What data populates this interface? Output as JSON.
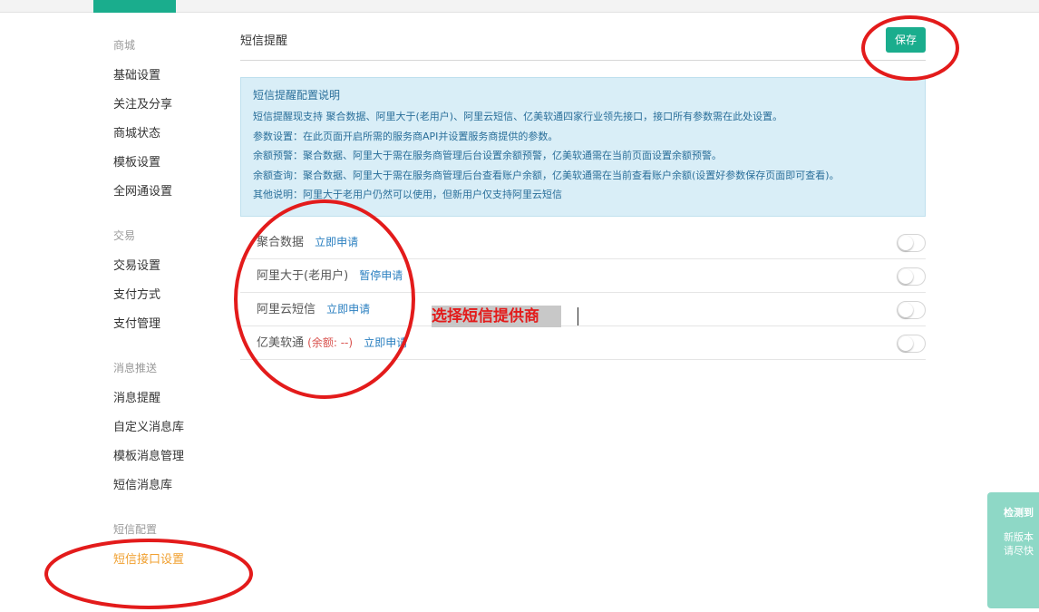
{
  "sidebar": {
    "groups": [
      {
        "title": "商城",
        "items": [
          "基础设置",
          "关注及分享",
          "商城状态",
          "模板设置",
          "全网通设置"
        ]
      },
      {
        "title": "交易",
        "items": [
          "交易设置",
          "支付方式",
          "支付管理"
        ]
      },
      {
        "title": "消息推送",
        "items": [
          "消息提醒",
          "自定义消息库",
          "模板消息管理",
          "短信消息库"
        ]
      },
      {
        "title": "短信配置",
        "items": [
          "短信接口设置"
        ]
      }
    ]
  },
  "main": {
    "title": "短信提醒",
    "save_label": "保存",
    "info": {
      "title": "短信提醒配置说明",
      "lines": [
        "短信提醒现支持 聚合数据、阿里大于(老用户)、阿里云短信、亿美软通四家行业领先接口，接口所有参数需在此处设置。",
        "参数设置：在此页面开启所需的服务商API并设置服务商提供的参数。",
        "余额预警：聚合数据、阿里大于需在服务商管理后台设置余额预警，亿美软通需在当前页面设置余额预警。",
        "余额查询：聚合数据、阿里大于需在服务商管理后台查看账户余额，亿美软通需在当前查看账户余额(设置好参数保存页面即可查看)。",
        "其他说明：阿里大于老用户仍然可以使用，但新用户仅支持阿里云短信"
      ]
    },
    "providers": [
      {
        "name": "聚合数据",
        "extra": "",
        "apply": "立即申请",
        "enabled": false
      },
      {
        "name": "阿里大于(老用户)",
        "extra": "",
        "apply": "暂停申请",
        "enabled": false
      },
      {
        "name": "阿里云短信",
        "extra": "",
        "apply": "立即申请",
        "enabled": false
      },
      {
        "name": "亿美软通",
        "extra": "(余额: --)",
        "apply": "立即申请",
        "enabled": false
      }
    ]
  },
  "annotation": {
    "text": "选择短信提供商"
  },
  "notice": {
    "title": "检测到",
    "lines": [
      "新版本",
      "请尽快"
    ]
  },
  "colors": {
    "accent": "#1aad8d",
    "active_item": "#f0a030",
    "annotation_red": "#e31b1b",
    "info_bg": "#d9eef7"
  }
}
